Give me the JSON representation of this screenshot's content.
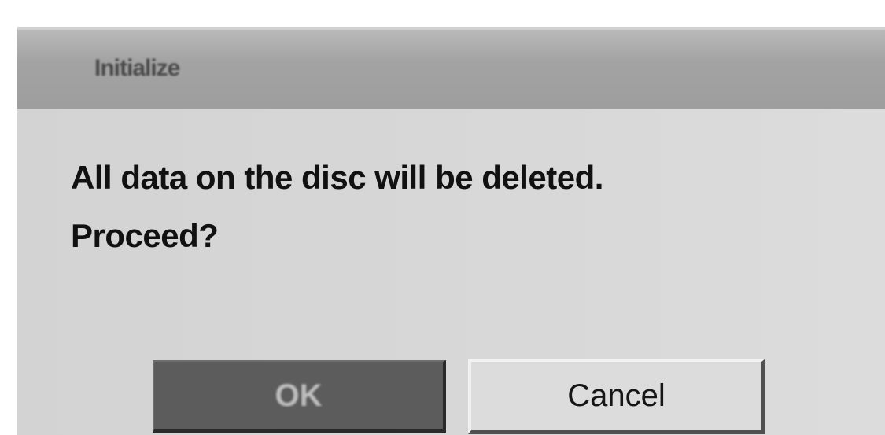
{
  "dialog": {
    "title": "Initialize",
    "message_line1": "All data on the disc will be deleted.",
    "message_line2": "Proceed?",
    "buttons": {
      "ok": "OK",
      "cancel": "Cancel"
    },
    "selected_button": "ok"
  }
}
